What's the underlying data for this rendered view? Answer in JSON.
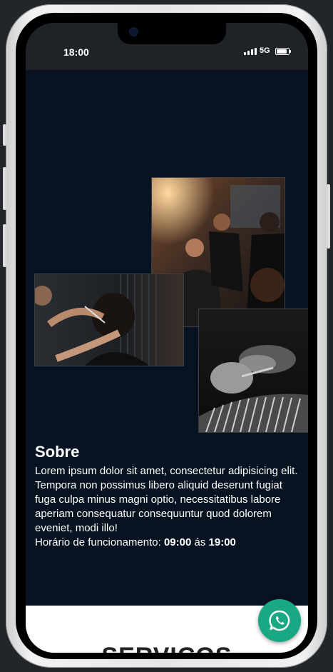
{
  "status_bar": {
    "time": "18:00",
    "network": "5G",
    "battery_level": 0.85
  },
  "about": {
    "title": "Sobre",
    "text": "Lorem ipsum dolor sit amet, consectetur adipisicing elit. Tempora non possimus libero aliquid deserunt fugiat fuga culpa minus magni optio, necessitatibus labore aperiam consequatur consequuntur quod dolorem eveniet, modi illo!",
    "hours_label": "Horário de funcionamento:",
    "hours_open": "09:00",
    "hours_separator": "ás",
    "hours_close": "19:00"
  },
  "services": {
    "title": "SERVIÇOS"
  },
  "icons": {
    "floating_button": "whatsapp-icon"
  },
  "colors": {
    "hero_background": "#071321",
    "whatsapp_green": "#1aa884"
  }
}
